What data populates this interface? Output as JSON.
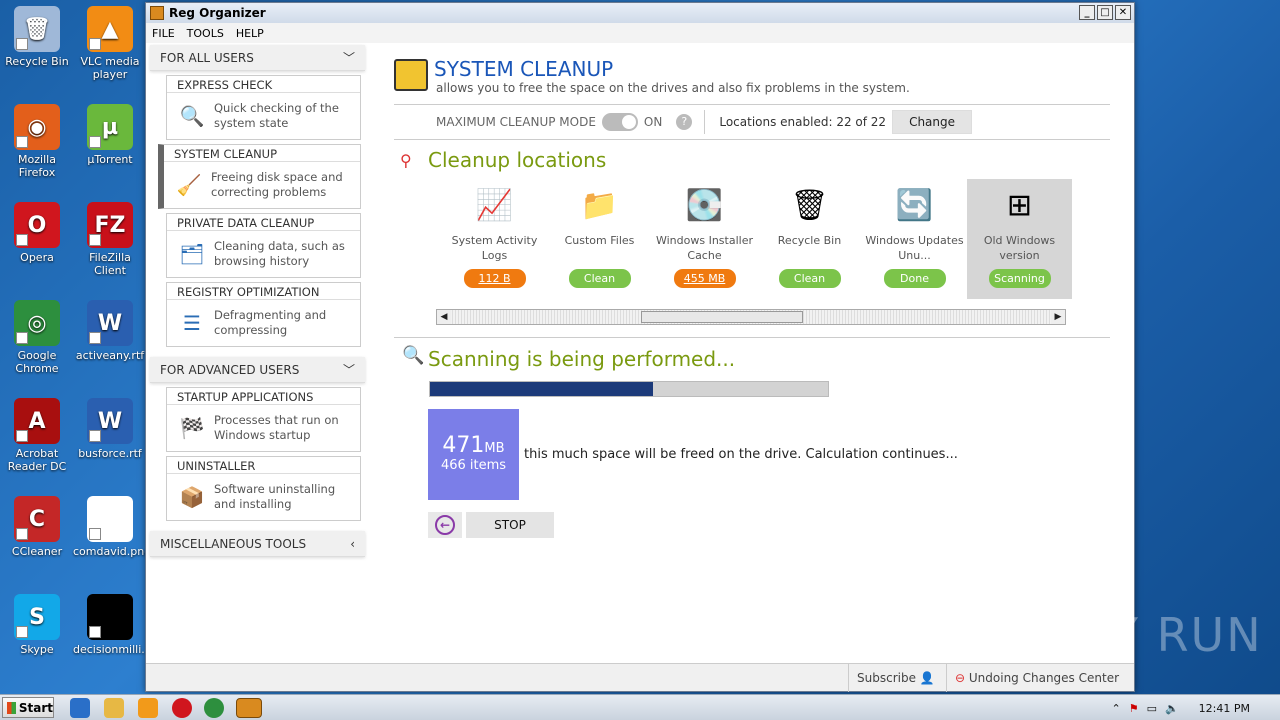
{
  "desktop": {
    "icons": [
      {
        "label": "Recycle Bin",
        "color": "#9fb8d8",
        "glyph": "🗑"
      },
      {
        "label": "VLC media player",
        "color": "#f28c14",
        "glyph": "▲"
      },
      {
        "label": "Mozilla Firefox",
        "color": "#e35f1b",
        "glyph": "◉"
      },
      {
        "label": "µTorrent",
        "color": "#6ab83c",
        "glyph": "µ"
      },
      {
        "label": "Opera",
        "color": "#d0161e",
        "glyph": "O"
      },
      {
        "label": "FileZilla Client",
        "color": "#c8101a",
        "glyph": "FZ"
      },
      {
        "label": "Google Chrome",
        "color": "#2d8f3e",
        "glyph": "◎"
      },
      {
        "label": "activeany.rtf",
        "color": "#2a5fb0",
        "glyph": "W"
      },
      {
        "label": "Acrobat Reader DC",
        "color": "#a80f0f",
        "glyph": "A"
      },
      {
        "label": "busforce.rtf",
        "color": "#2a5fb0",
        "glyph": "W"
      },
      {
        "label": "CCleaner",
        "color": "#c42727",
        "glyph": "C"
      },
      {
        "label": "comdavid.png",
        "color": "#ffffff",
        "glyph": ""
      },
      {
        "label": "Skype",
        "color": "#12a8e8",
        "glyph": "S"
      },
      {
        "label": "decisionmilli...",
        "color": "#000000",
        "glyph": ""
      }
    ]
  },
  "window": {
    "title": "Reg Organizer",
    "menu": [
      "FILE",
      "TOOLS",
      "HELP"
    ]
  },
  "sidebar": {
    "for_all_users": "FOR ALL USERS",
    "for_advanced_users": "FOR ADVANCED USERS",
    "misc_tools": "MISCELLANEOUS TOOLS",
    "cards_all": [
      {
        "title": "EXPRESS CHECK",
        "desc": "Quick checking of the system state",
        "icon": "🔍"
      },
      {
        "title": "SYSTEM CLEANUP",
        "desc": "Freeing disk space and correcting problems",
        "icon": "🧹"
      },
      {
        "title": "PRIVATE DATA CLEANUP",
        "desc": "Cleaning data, such as browsing history",
        "icon": "🗂"
      },
      {
        "title": "REGISTRY OPTIMIZATION",
        "desc": "Defragmenting and compressing",
        "icon": "☰"
      }
    ],
    "cards_adv": [
      {
        "title": "STARTUP APPLICATIONS",
        "desc": "Processes that run on Windows startup",
        "icon": "🏁"
      },
      {
        "title": "UNINSTALLER",
        "desc": "Software uninstalling and installing",
        "icon": "📦"
      }
    ]
  },
  "main": {
    "title": "SYSTEM CLEANUP",
    "subtitle": "allows you to free the space on the drives and also fix problems in the system.",
    "mode_label": "MAXIMUM CLEANUP MODE",
    "mode_state": "ON",
    "locations_enabled": "Locations enabled: 22 of 22",
    "change_label": "Change",
    "locations_title": "Cleanup locations",
    "locations": [
      {
        "name": "System Activity Logs",
        "status": "112 B",
        "kind": "orange",
        "icon": "📈"
      },
      {
        "name": "Custom Files",
        "status": "Clean",
        "kind": "green",
        "icon": "📁"
      },
      {
        "name": "Windows Installer Cache",
        "status": "455 MB",
        "kind": "orange",
        "icon": "💽"
      },
      {
        "name": "Recycle Bin",
        "status": "Clean",
        "kind": "green",
        "icon": "🗑"
      },
      {
        "name": "Windows Updates Unu...",
        "status": "Done",
        "kind": "green",
        "icon": "🔄"
      },
      {
        "name": "Old Windows version",
        "status": "Scanning",
        "kind": "green",
        "icon": "⊞"
      }
    ],
    "scan_title": "Scanning is being performed...",
    "progress": 0.56,
    "size_value": "471",
    "size_unit": "MB",
    "items_count": "466 items",
    "freed_text": "this much space will be freed on the drive. Calculation continues...",
    "stop_label": "STOP"
  },
  "statusbar": {
    "subscribe": "Subscribe",
    "undo_center": "Undoing Changes Center"
  },
  "taskbar": {
    "start": "Start",
    "time": "12:41 PM"
  },
  "watermark": "ANY RUN"
}
